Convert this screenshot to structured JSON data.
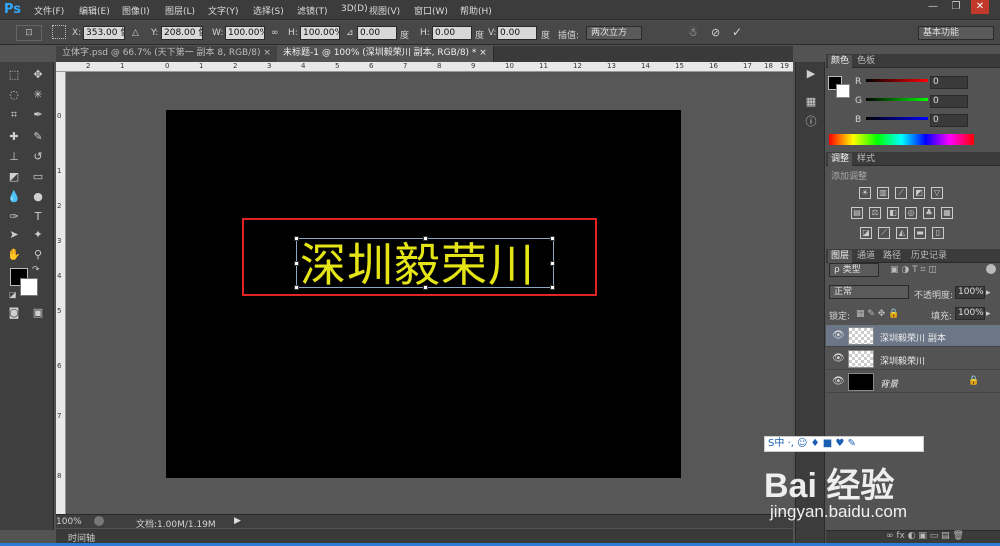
{
  "app": {
    "logo": "Ps"
  },
  "menu": [
    "文件(F)",
    "编辑(E)",
    "图像(I)",
    "图层(L)",
    "文字(Y)",
    "选择(S)",
    "滤镜(T)",
    "3D(D)",
    "视图(V)",
    "窗口(W)",
    "帮助(H)"
  ],
  "window_buttons": {
    "minimize": "—",
    "restore": "❐",
    "close": "✕"
  },
  "options": {
    "x_label": "X:",
    "x_value": "353.00 像",
    "y_label": "Y:",
    "y_value": "208.00 像",
    "w_label": "W:",
    "w_value": "100.00%",
    "h_label": "H:",
    "h_value": "100.00%",
    "angle_value": "0.00",
    "angle_unit": "度",
    "hskew_label": "H:",
    "hskew_value": "0.00",
    "hskew_unit": "度",
    "vskew_label": "V:",
    "vskew_value": "0.00",
    "vskew_unit": "度",
    "interp_label": "插值:",
    "interp_value": "两次立方",
    "workspace": "基本功能"
  },
  "tabs": [
    {
      "label": "立体字.psd @ 66.7% (天下第一 副本 8, RGB/8)",
      "close": "×"
    },
    {
      "label": "未标题-1 @ 100% (深圳毅荣川 副本, RGB/8) *",
      "close": "×"
    }
  ],
  "ruler": {
    "top": [
      "2",
      "1",
      "0",
      "1",
      "2",
      "3",
      "4",
      "5",
      "6",
      "7",
      "8",
      "9",
      "10",
      "11",
      "12",
      "13",
      "14",
      "15",
      "16",
      "17",
      "18",
      "19"
    ],
    "left": [
      "0",
      "1",
      "2",
      "3",
      "4",
      "5",
      "6",
      "7",
      "8"
    ]
  },
  "canvas": {
    "text": "深圳毅荣川",
    "text_color": "#e4e416",
    "highlight_color": "#e02424"
  },
  "status": {
    "zoom": "100%",
    "doc_info": "文档:1.00M/1.19M"
  },
  "timeline": "时间轴",
  "color_panel": {
    "tabs": [
      "颜色",
      "色板"
    ],
    "channels": [
      {
        "label": "R",
        "value": "0"
      },
      {
        "label": "G",
        "value": "0"
      },
      {
        "label": "B",
        "value": "0"
      }
    ]
  },
  "adjust_panel": {
    "tabs": [
      "调整",
      "样式"
    ],
    "title": "添加调整"
  },
  "layers_panel": {
    "tabs": [
      "图层",
      "通道",
      "路径",
      "历史记录"
    ],
    "filter": "ρ 类型",
    "blend_mode": "正常",
    "opacity_label": "不透明度:",
    "opacity_value": "100%",
    "lock_label": "锁定:",
    "fill_label": "填充:",
    "fill_value": "100%",
    "layers": [
      {
        "name": "深圳毅荣川 副本",
        "selected": true,
        "thumb": "transparent"
      },
      {
        "name": "深圳毅荣川",
        "selected": false,
        "thumb": "transparent"
      },
      {
        "name": "背景",
        "selected": false,
        "thumb": "black",
        "locked": true
      }
    ]
  },
  "watermark": {
    "ime": "S中 ·, ☺ ♦ ■ ♥ ✎",
    "brand": "Bai 经验",
    "url": "jingyan.baidu.com"
  }
}
